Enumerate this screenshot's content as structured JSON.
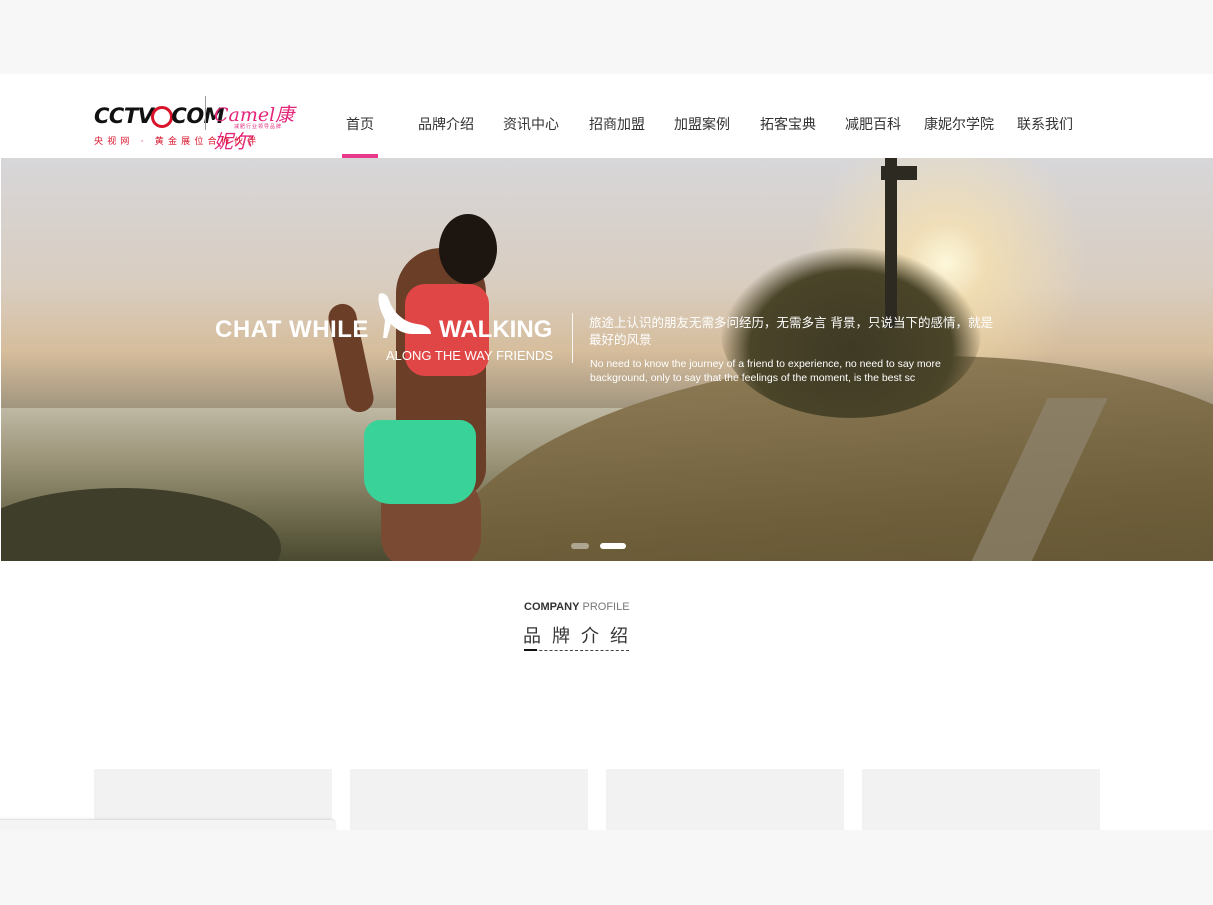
{
  "logo": {
    "cctv_text_pre": "CCTV",
    "cctv_text_post": "COM",
    "camel_text": "Camel康妮尔",
    "camel_sub": "减肥行业领导品牌",
    "tagline": "央视网 · 黄金展位合作伙伴"
  },
  "nav": {
    "active_index": 0,
    "items": [
      {
        "label": "首页"
      },
      {
        "label": "品牌介绍"
      },
      {
        "label": "资讯中心"
      },
      {
        "label": "招商加盟"
      },
      {
        "label": "加盟案例"
      },
      {
        "label": "拓客宝典"
      },
      {
        "label": "减肥百科"
      },
      {
        "label": "康妮尔学院"
      },
      {
        "label": "联系我们"
      }
    ]
  },
  "banner": {
    "slogan_main": "CHAT WHILE",
    "slogan_walk": "WALKING",
    "slogan_sub": "ALONG THE WAY FRIENDS",
    "text_cn": "旅途上认识的朋友无需多问经历，无需多言 背景，只说当下的感情，就是最好的风景",
    "text_en": "No need to know the journey of a friend to experience, no need to say more background, only to say that the feelings of the moment, is the best sc",
    "slides_count": 2,
    "active_slide": 1
  },
  "profile": {
    "en_bold": "COMPANY",
    "en_light": "PROFILE",
    "cn_title": "品牌介绍"
  },
  "colors": {
    "accent": "#e53b8a",
    "logo_red": "#d8132a",
    "logo_pink": "#e4267a",
    "card_bg": "#f2f2f2",
    "page_bg": "#f7f7f7"
  }
}
